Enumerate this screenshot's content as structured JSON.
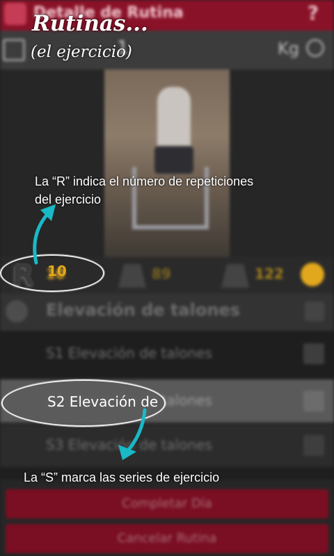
{
  "app": {
    "title": "Detalle de Rutina",
    "help_icon": "question-icon",
    "toolbar": {
      "number": "1",
      "unit": "Kg"
    }
  },
  "stats": {
    "reps_letter": "R",
    "reps_value": "10",
    "weight1_value": "89",
    "weight2_value": "122"
  },
  "exercise": {
    "name": "Elevación de talones",
    "series": [
      {
        "label": "S1 Elevación de talones"
      },
      {
        "label": "S2 Elevación de talones"
      },
      {
        "label": "S3 Elevación de talones"
      }
    ]
  },
  "buttons": {
    "complete_day": "Completar Día",
    "cancel_routine": "Cancelar Rutina"
  },
  "overlay": {
    "title": "Rutinas...",
    "subtitle": "(el ejercicio)",
    "note_r_line1": "La “R” indica el número de repeticiones",
    "note_r_line2": "del ejercicio",
    "note_s": "La “S” marca las series de ejercicio",
    "s_bubble_text": "S2 Elevación de",
    "arrow_color": "#19b9c6"
  }
}
